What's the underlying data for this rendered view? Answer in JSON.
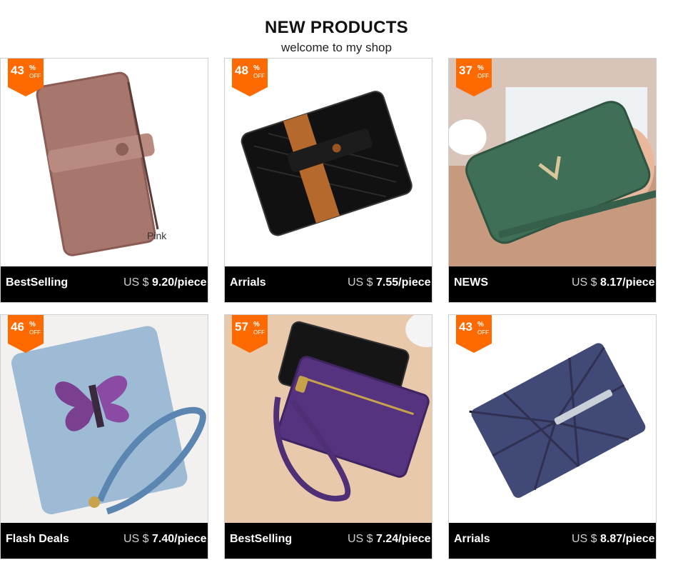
{
  "header": {
    "title": "NEW PRODUCTS",
    "subtitle": "welcome to my shop"
  },
  "badge_off": "OFF",
  "badge_pct": "%",
  "currency": "US $",
  "products": [
    {
      "discount": "43",
      "category": "BestSelling",
      "price": "9.20/piece",
      "note": "Pink",
      "image": "brown-leather-wallet"
    },
    {
      "discount": "48",
      "category": "Arrials",
      "price": "7.55/piece",
      "image": "black-leather-wallet"
    },
    {
      "discount": "37",
      "category": "NEWS",
      "price": "8.17/piece",
      "image": "green-zip-wallet"
    },
    {
      "discount": "46",
      "category": "Flash Deals",
      "price": "7.40/piece",
      "image": "denim-butterfly-wallet"
    },
    {
      "discount": "57",
      "category": "BestSelling",
      "price": "7.24/piece",
      "image": "purple-coin-purse"
    },
    {
      "discount": "43",
      "category": "Arrials",
      "price": "8.87/piece",
      "image": "geometric-holographic-wallet"
    }
  ],
  "colors": {
    "badge": "#ff6a00",
    "bar": "#000000"
  }
}
